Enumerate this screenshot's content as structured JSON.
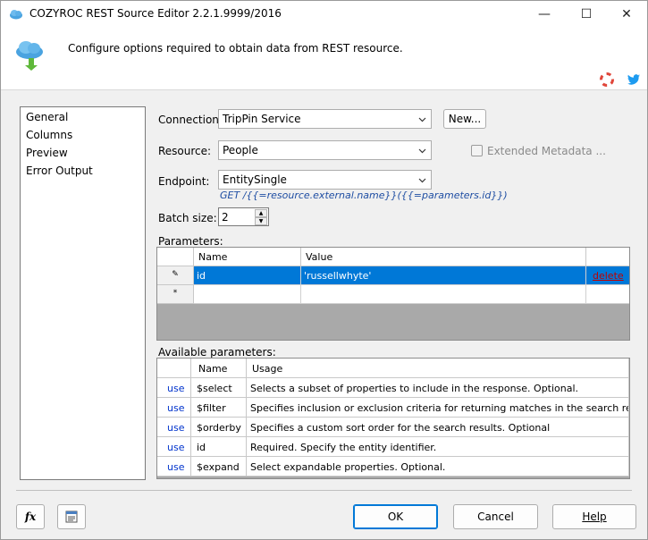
{
  "window": {
    "title": "COZYROC REST Source Editor 2.2.1.9999/2016",
    "minimize": "—",
    "maximize": "☐",
    "close": "✕"
  },
  "header": {
    "text": "Configure options required to obtain data from REST resource.",
    "icon": "cloud-arrow-icon",
    "links": [
      "lifebuoy-icon",
      "twitter-icon"
    ]
  },
  "nav": {
    "items": [
      "General",
      "Columns",
      "Preview",
      "Error Output"
    ],
    "selected": "General"
  },
  "form": {
    "connection_label": "Connection:",
    "connection_value": "TripPin Service",
    "new_button": "New...",
    "resource_label": "Resource:",
    "resource_value": "People",
    "extended_metadata_label": "Extended Metadata ...",
    "extended_metadata_checked": false,
    "endpoint_label": "Endpoint:",
    "endpoint_value": "EntitySingle",
    "endpoint_hint": "GET /{{=resource.external.name}}({{=parameters.id}})",
    "batch_label": "Batch size:",
    "batch_value": "2"
  },
  "parameters": {
    "label": "Parameters:",
    "columns": [
      "Name",
      "Value"
    ],
    "rows": [
      {
        "name": "id",
        "value": "'russellwhyte'",
        "action": "delete",
        "selected": true
      }
    ],
    "new_row_marker": "*"
  },
  "available": {
    "label": "Available parameters:",
    "columns": [
      "Name",
      "Usage"
    ],
    "rows": [
      {
        "action": "use",
        "name": "$select",
        "usage": "Selects a subset of properties to include in the response. Optional."
      },
      {
        "action": "use",
        "name": "$filter",
        "usage": "Specifies inclusion or exclusion criteria for returning matches in the search results. Op..."
      },
      {
        "action": "use",
        "name": "$orderby",
        "usage": "Specifies a custom sort order for the search results. Optional"
      },
      {
        "action": "use",
        "name": "id",
        "usage": "Required. Specify the entity identifier."
      },
      {
        "action": "use",
        "name": "$expand",
        "usage": "Select expandable properties. Optional."
      }
    ]
  },
  "footer": {
    "fx_button": "fx",
    "ok": "OK",
    "cancel": "Cancel",
    "help": "Help"
  },
  "colors": {
    "selection": "#0078d7",
    "link": "#0033cc",
    "delete_link": "#c00000",
    "hint": "#1f4ea3"
  }
}
